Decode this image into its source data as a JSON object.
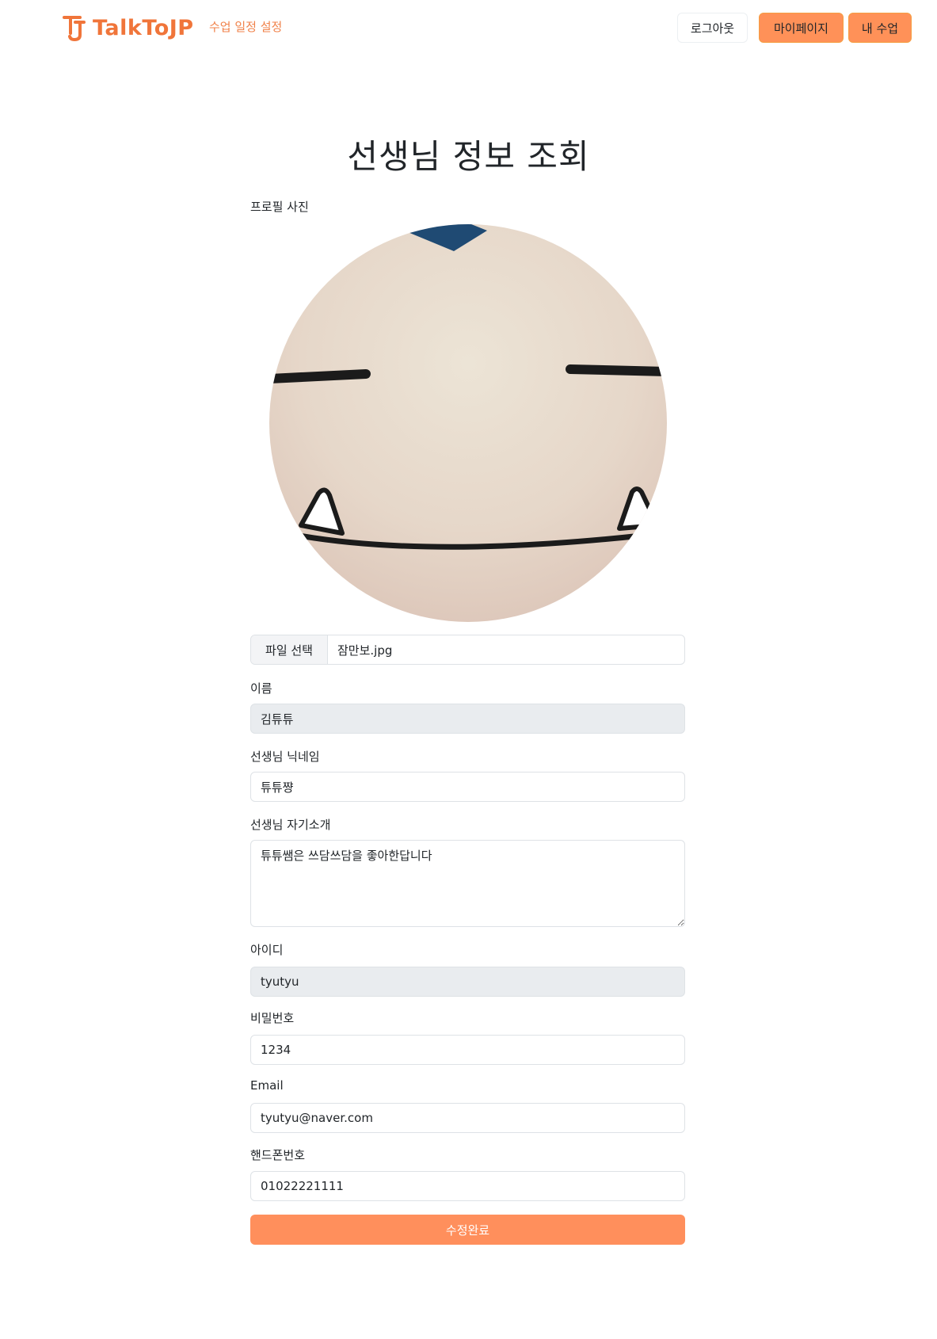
{
  "navbar": {
    "brand_name": "TalkToJP",
    "schedule_link": "수업 일정 설정",
    "logout_label": "로그아웃",
    "mypage_label": "마이페이지",
    "myclass_label": "내 수업",
    "accent_color": "#f0753a"
  },
  "page": {
    "title": "선생님 정보 조회"
  },
  "form": {
    "profile_label": "프로필 사진",
    "file_button_label": "파일 선택",
    "file_name": "잠만보.jpg",
    "name_label": "이름",
    "name_value": "김튜튜",
    "nickname_label": "선생님 닉네임",
    "nickname_value": "튜튜쨩",
    "intro_label": "선생님 자기소개",
    "intro_value": "튜튜쌤은 쓰담쓰담을 좋아한답니다",
    "id_label": "아이디",
    "id_value": "tyutyu",
    "password_label": "비밀번호",
    "password_value": "1234",
    "email_label": "Email",
    "email_value": "tyutyu@naver.com",
    "phone_label": "핸드폰번호",
    "phone_value": "01022221111",
    "submit_label": "수정완료",
    "submit_color": "#ff8f5c"
  }
}
